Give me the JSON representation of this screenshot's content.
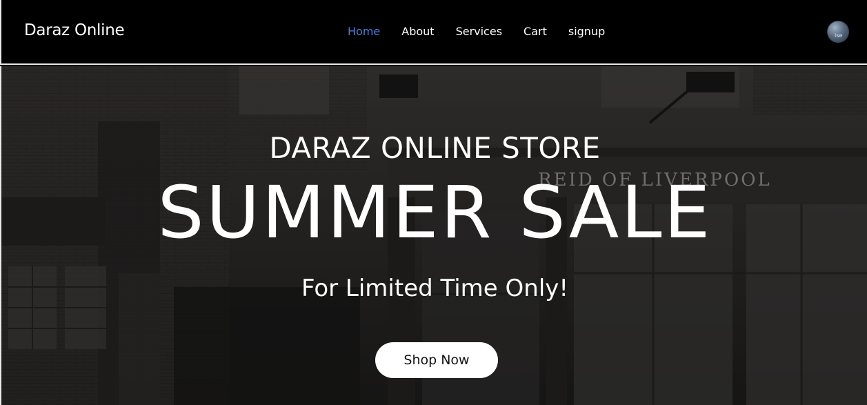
{
  "header": {
    "brand": "Daraz Online",
    "nav": [
      {
        "label": "Home",
        "active": true
      },
      {
        "label": "About",
        "active": false
      },
      {
        "label": "Services",
        "active": false
      },
      {
        "label": "Cart",
        "active": false
      },
      {
        "label": "signup",
        "active": false
      }
    ],
    "avatar_alt": "ise"
  },
  "hero": {
    "eyebrow": "DARAZ ONLINE STORE",
    "headline": "SUMMER SALE",
    "subheadline": "For Limited Time Only!",
    "cta_label": "Shop Now",
    "background_sign": "REID OF LIVERPOOL"
  },
  "colors": {
    "accent": "#4a7fd8",
    "header_bg": "#000000",
    "text": "#ffffff",
    "button_bg": "#ffffff"
  }
}
